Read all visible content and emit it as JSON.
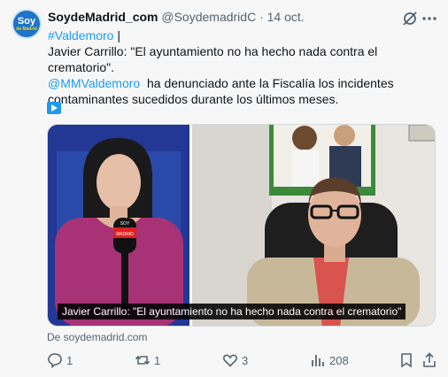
{
  "tweet": {
    "avatar_text_top": "Soy",
    "avatar_text_bottom": "de Madrid",
    "display_name": "SoydeMadrid_com",
    "meta": "@SoydemadridC · 14 oct.",
    "hashtag": "#Valdemoro",
    "hashtag_after": " |",
    "line1": "Javier Carrillo: \"El ayuntamiento no ha hecho nada contra el crematorio\".",
    "mention": "@MMValdemoro",
    "line2_rest": "  ha denunciado ante la Fiscalía los incidentes contaminantes sucedidos durante los últimos meses.",
    "source": "De soydemadrid.com"
  },
  "video": {
    "caption": "Javier Carrillo: \"El ayuntamiento no ha hecho nada contra el crematorio\"",
    "mic_logo_line1": "SOY",
    "mic_logo_line2": "MADRID"
  },
  "actions": {
    "replies": "1",
    "reposts": "1",
    "likes": "3",
    "views": "208"
  },
  "icons": [
    "grok-icon",
    "more-icon",
    "play-icon",
    "reply-icon",
    "repost-icon",
    "like-icon",
    "views-icon",
    "bookmark-icon",
    "share-icon"
  ],
  "colors": {
    "link": "#1d9bf0",
    "muted": "#536471",
    "text": "#0f1419"
  }
}
